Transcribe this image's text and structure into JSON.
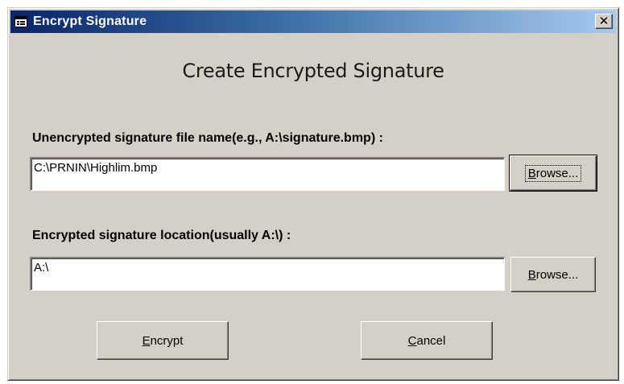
{
  "window": {
    "title": "Encrypt Signature",
    "close_glyph": "✕",
    "icon": "form-icon"
  },
  "heading": "Create Encrypted Signature",
  "source": {
    "label": "Unencrypted signature file name(e.g.,  A:\\signature.bmp) :",
    "value": "C:\\PRNIN\\Highlim.bmp",
    "browse": {
      "mnemonic": "B",
      "rest": "rowse..."
    }
  },
  "destination": {
    "label": "Encrypted signature location(usually   A:\\) :",
    "value": "A:\\",
    "browse": {
      "mnemonic": "B",
      "rest": "rowse..."
    }
  },
  "actions": {
    "encrypt": {
      "mnemonic": "E",
      "rest": "ncrypt"
    },
    "cancel": {
      "mnemonic": "C",
      "rest": "ancel"
    }
  },
  "colors": {
    "face": "#d4d0c8",
    "title_start": "#0a246a",
    "title_end": "#a6caf0"
  }
}
